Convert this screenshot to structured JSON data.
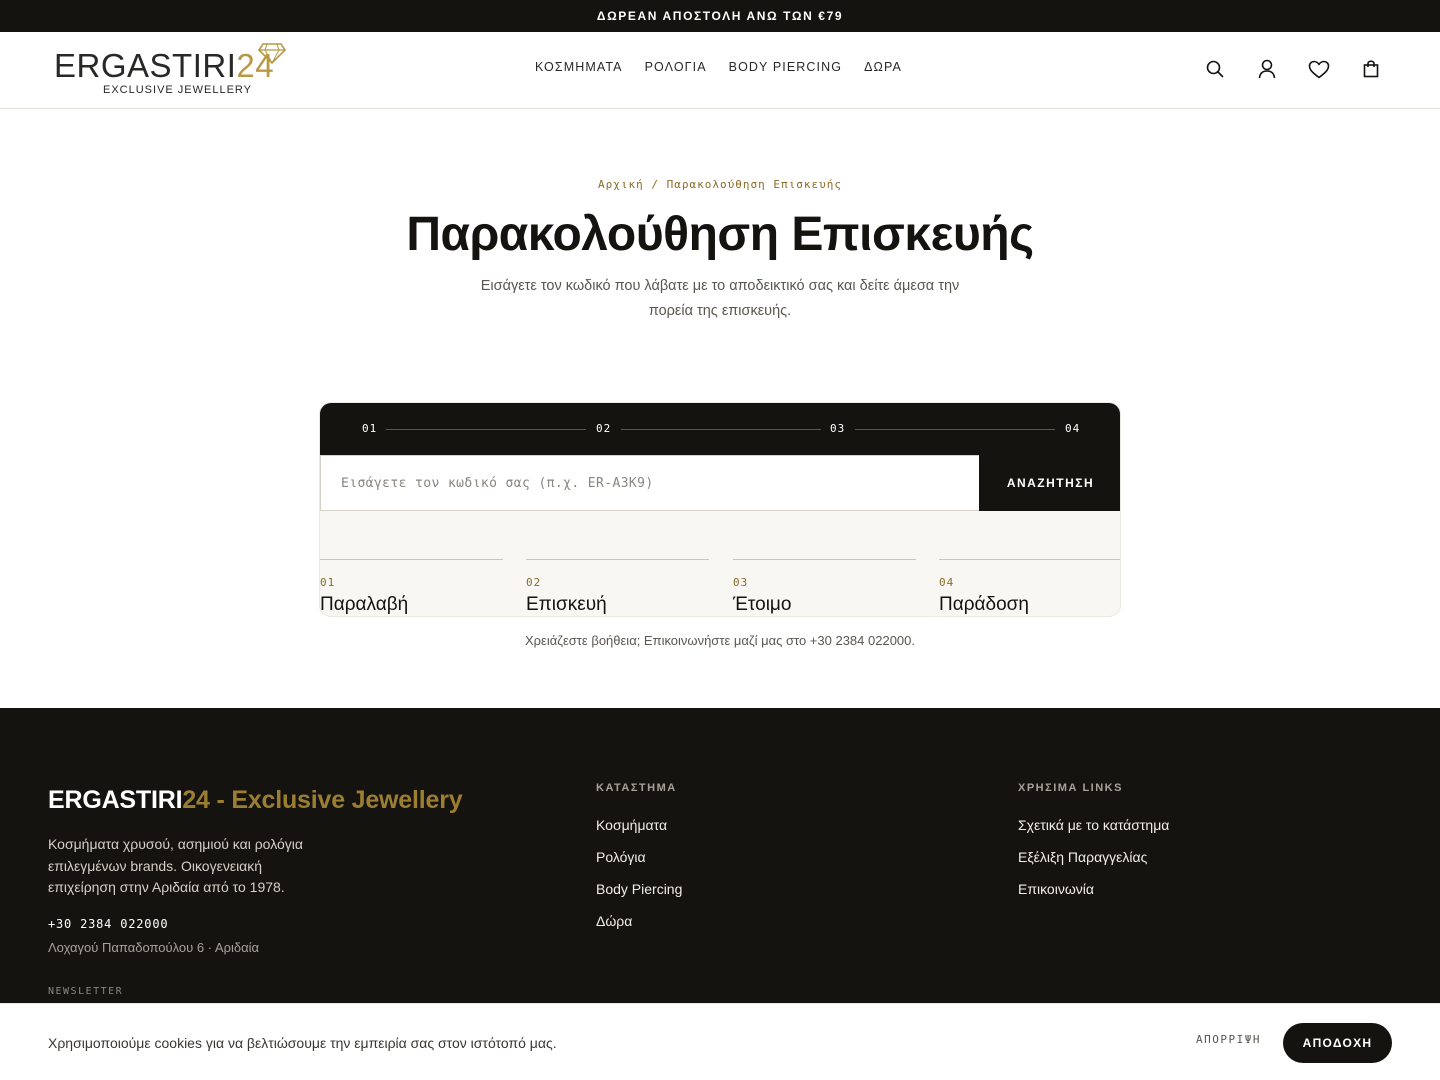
{
  "announcement": "ΔΩΡΕΑΝ ΑΠΟΣΤΟΛΗ ΑΝΩ ΤΩΝ €79",
  "logo": {
    "main": "ERGASTIRI",
    "number": "24",
    "tagline": "EXCLUSIVE JEWELLERY"
  },
  "nav": [
    "ΚΟΣΜΗΜΑΤΑ",
    "ΡΟΛΟΓΙΑ",
    "BODY PIERCING",
    "ΔΩΡΑ"
  ],
  "header_icons": [
    "search-icon",
    "user-icon",
    "heart-icon",
    "bag-icon"
  ],
  "breadcrumb": "Αρχική / Παρακολούθηση Επισκευής",
  "title": "Παρακολούθηση Επισκευής",
  "subtitle": "Εισάγετε τον κωδικό που λάβατε με το αποδεικτικό σας και δείτε άμεσα την πορεία της επισκευής.",
  "tracker": {
    "rail": [
      "01",
      "02",
      "03",
      "04"
    ],
    "search_placeholder": "Εισάγετε τον κωδικό σας (π.χ. ER-A3K9)",
    "search_value": "",
    "search_button": "ΑΝΑΖΗΤΗΣΗ",
    "steps": [
      {
        "num": "01",
        "label": "Παραλαβή"
      },
      {
        "num": "02",
        "label": "Επισκευή"
      },
      {
        "num": "03",
        "label": "Έτοιμο"
      },
      {
        "num": "04",
        "label": "Παράδοση"
      }
    ]
  },
  "help": "Χρειάζεστε βοήθεια; Επικοινωνήστε μαζί μας στο +30 2384 022000.",
  "footer": {
    "brand_main": "ERGASTIRI",
    "brand_accent": "24 - Exclusive Jewellery",
    "description": "Κοσμήματα χρυσού, ασημιού και ρολόγια επιλεγμένων brands. Οικογενειακή επιχείρηση στην Αριδαία από το 1978.",
    "phone": "+30 2384 022000",
    "address": "Λοχαγού Παπαδοπούλου 6 · Αριδαία",
    "newsletter": "NEWSLETTER",
    "store": {
      "heading": "ΚΑΤΑΣΤΗΜΑ",
      "links": [
        "Κοσμήματα",
        "Ρολόγια",
        "Body Piercing",
        "Δώρα"
      ]
    },
    "useful": {
      "heading": "ΧΡΗΣΙΜΑ LINKS",
      "links": [
        "Σχετικά με το κατάστημα",
        "Εξέλιξη Παραγγελίας",
        "Επικοινωνία"
      ]
    }
  },
  "cookie": {
    "text": "Χρησιμοποιούμε cookies για να βελτιώσουμε την εμπειρία σας στον ιστότοπό μας.",
    "reject": "ΑΠΟΡΡΙΨΗ",
    "accept": "ΑΠΟΔΟΧΗ"
  },
  "colors": {
    "dark": "#15130f",
    "gold": "#b89845",
    "gold_dark": "#8a6c28",
    "muted": "#5a5650"
  }
}
